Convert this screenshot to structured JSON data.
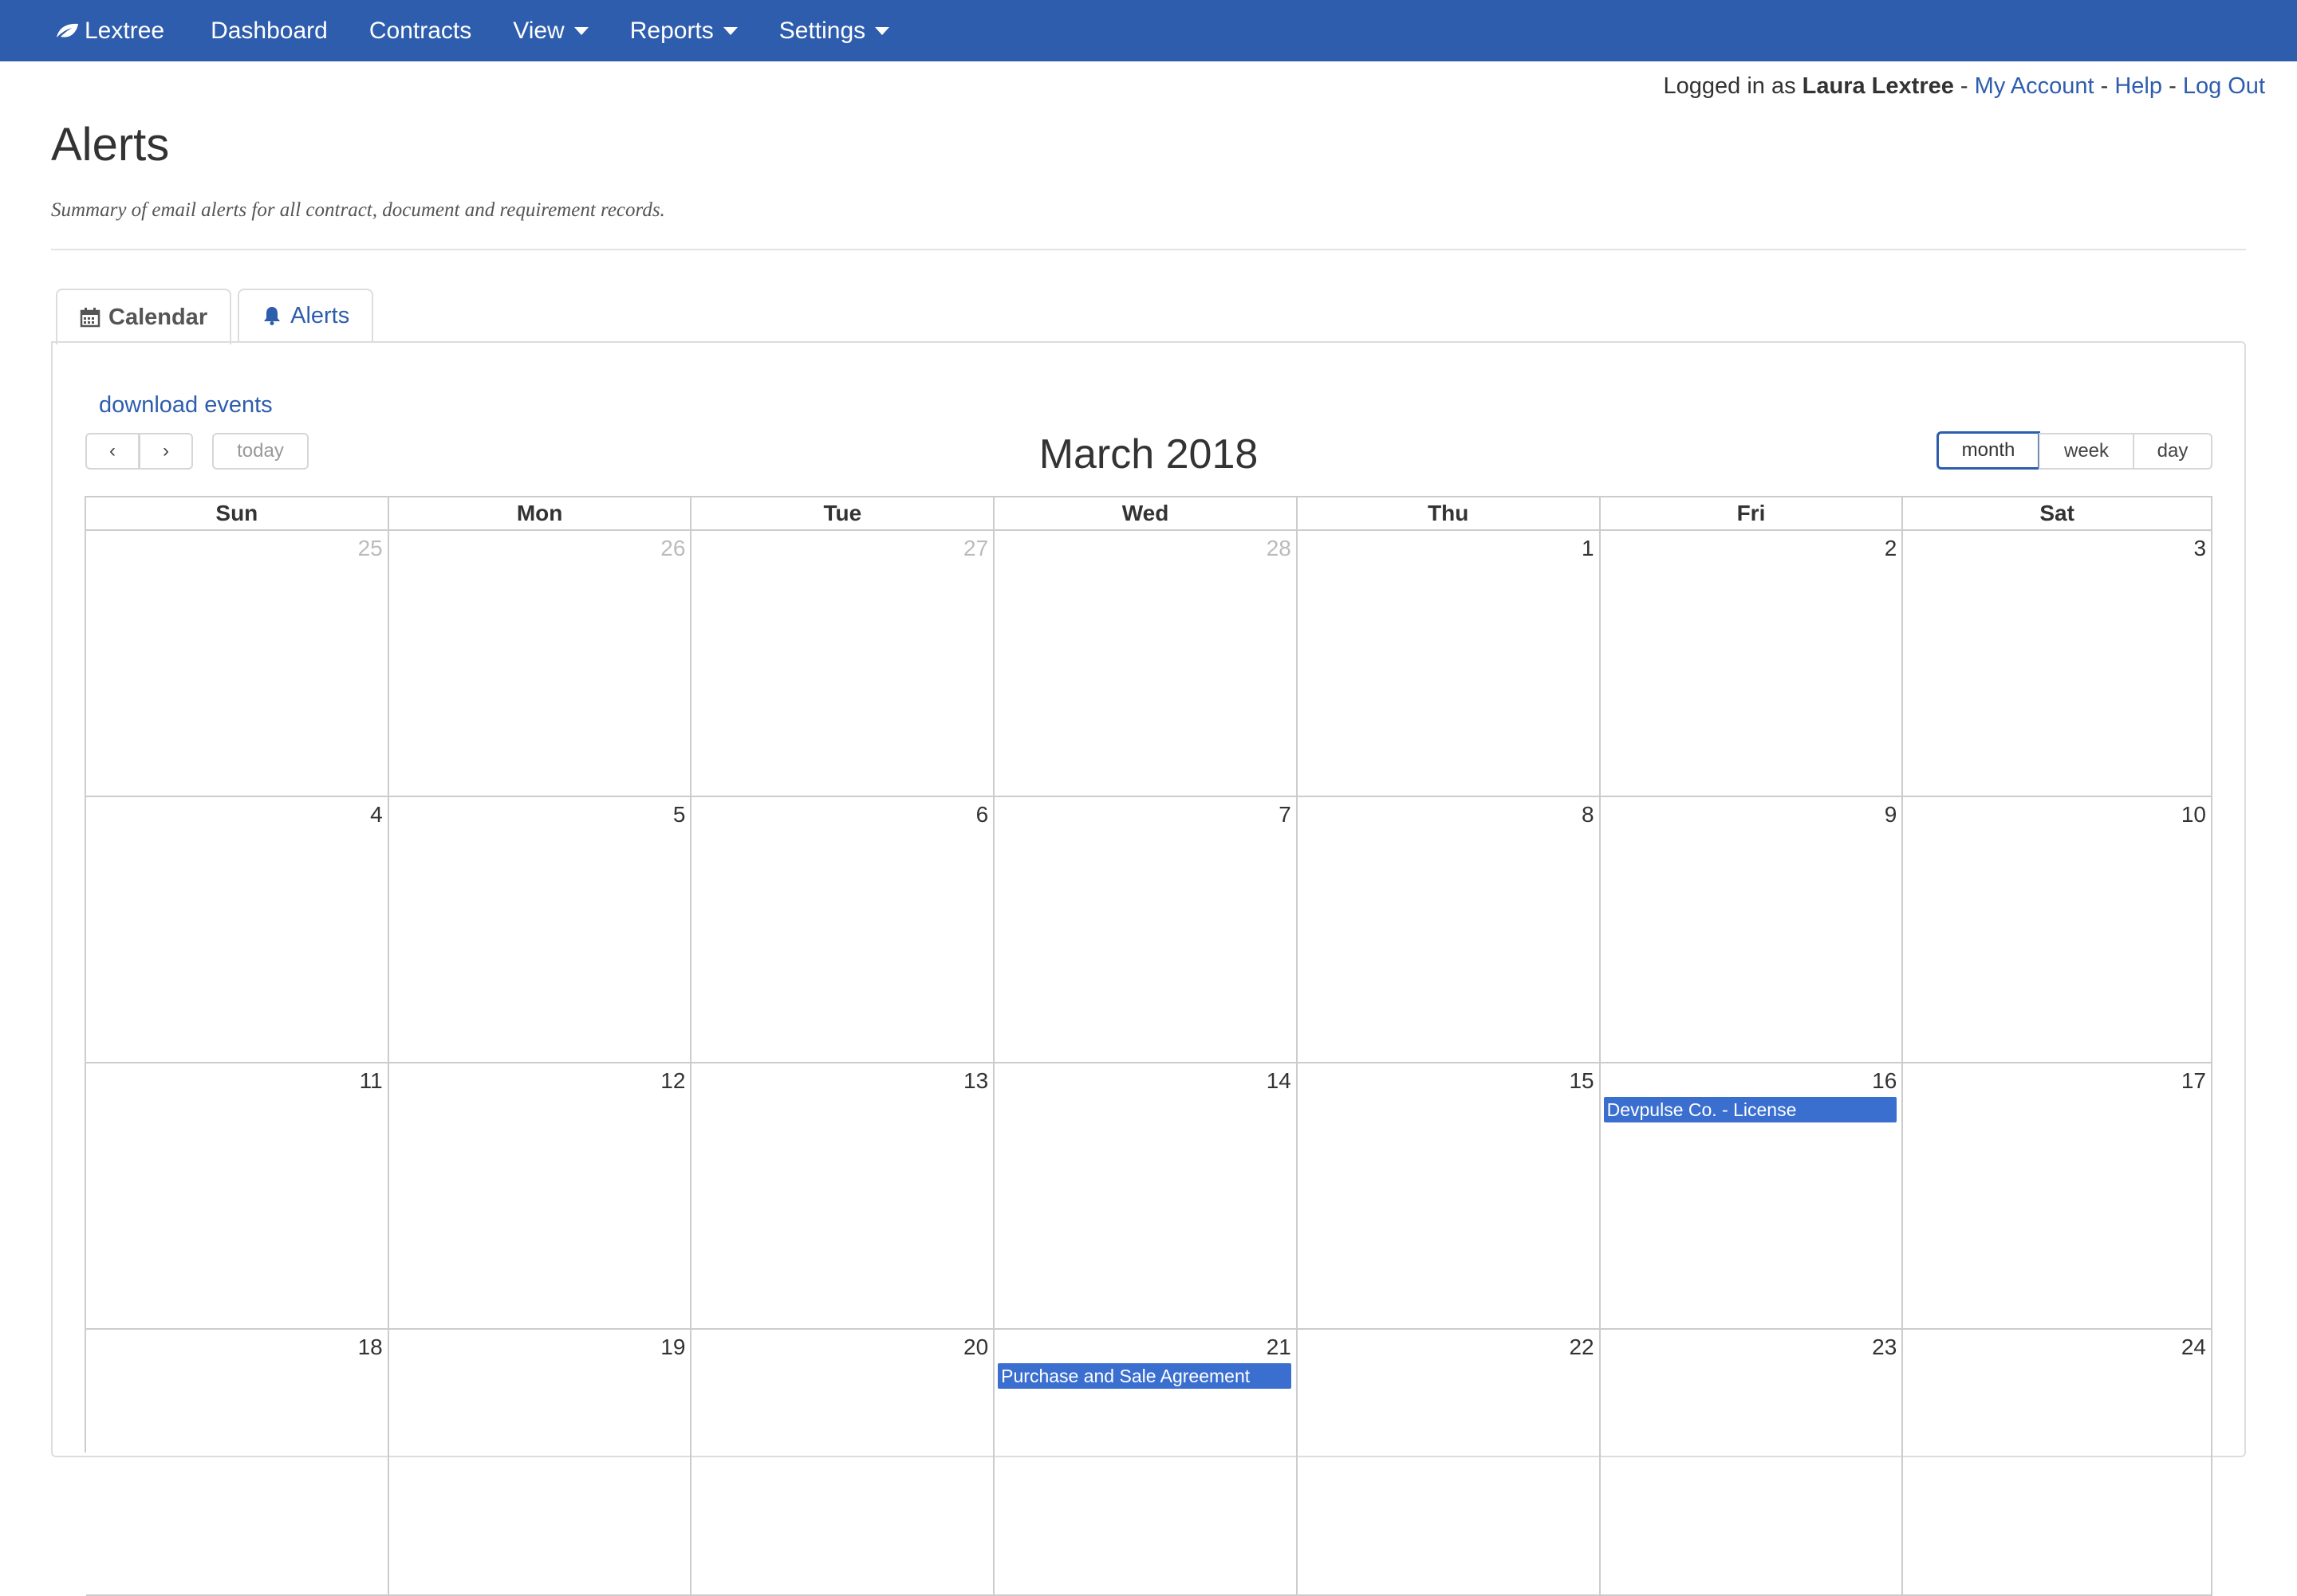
{
  "navbar": {
    "brand": "Lextree",
    "items": [
      {
        "label": "Dashboard"
      },
      {
        "label": "Contracts"
      },
      {
        "label": "View"
      },
      {
        "label": "Reports"
      },
      {
        "label": "Settings"
      }
    ],
    "color": "#2e5dad"
  },
  "userbar": {
    "prefix": "Logged in as",
    "user": "Laura Lextree",
    "sep": "-",
    "my_account": "My Account",
    "help": "Help",
    "logout": "Log Out"
  },
  "page": {
    "title": "Alerts",
    "subtitle": "Summary of email alerts for all contract, document and requirement records."
  },
  "tabs": [
    {
      "label": "Calendar",
      "icon": "calendar-icon",
      "active": true
    },
    {
      "label": "Alerts",
      "icon": "bell-icon",
      "active": false
    }
  ],
  "calendar": {
    "download_label": "download events",
    "prev_label": "‹",
    "next_label": "›",
    "today_label": "today",
    "title": "March 2018",
    "views": {
      "month": "month",
      "week": "week",
      "day": "day"
    },
    "selected_view": "month",
    "weekdays": [
      "Sun",
      "Mon",
      "Tue",
      "Wed",
      "Thu",
      "Fri",
      "Sat"
    ],
    "weeks": [
      [
        "25",
        "26",
        "27",
        "28",
        "1",
        "2",
        "3"
      ],
      [
        "4",
        "5",
        "6",
        "7",
        "8",
        "9",
        "10"
      ],
      [
        "11",
        "12",
        "13",
        "14",
        "15",
        "16",
        "17"
      ],
      [
        "18",
        "19",
        "20",
        "21",
        "22",
        "23",
        "24"
      ]
    ],
    "other_month_days": [
      "25",
      "26",
      "27",
      "28"
    ],
    "events": [
      {
        "week": 2,
        "day": 5,
        "title": "Devpulse Co. - License"
      },
      {
        "week": 3,
        "day": 3,
        "title": "Purchase and Sale Agreement"
      }
    ],
    "event_color": "#3a6fd0"
  }
}
